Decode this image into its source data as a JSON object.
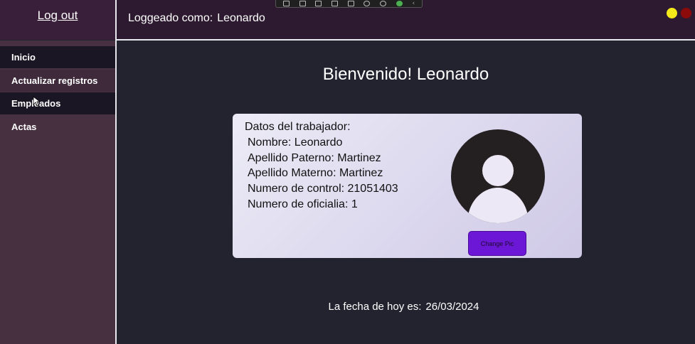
{
  "header": {
    "logout_label": "Log out",
    "logged_as_label": "Loggeado como:",
    "user_name": "Leonardo"
  },
  "sidebar": {
    "items": [
      {
        "label": "Inicio"
      },
      {
        "label": "Actualizar registros"
      },
      {
        "label": "Empleados"
      },
      {
        "label": "Actas"
      }
    ]
  },
  "main": {
    "welcome": "Bienvenido! Leonardo",
    "card": {
      "title": "Datos del trabajador:",
      "fields": [
        "Nombre: Leonardo",
        "Apellido Paterno: Martinez",
        "Apellido Materno: Martinez",
        "Numero de control: 21051403",
        "Numero de oficialia: 1"
      ],
      "change_pic_label": "Change Pic"
    },
    "date_label": "La fecha de hoy es:",
    "date_value": "26/03/2024"
  },
  "window_controls": {
    "yellow": "#f4ea1a",
    "red": "#8b0a0a"
  }
}
